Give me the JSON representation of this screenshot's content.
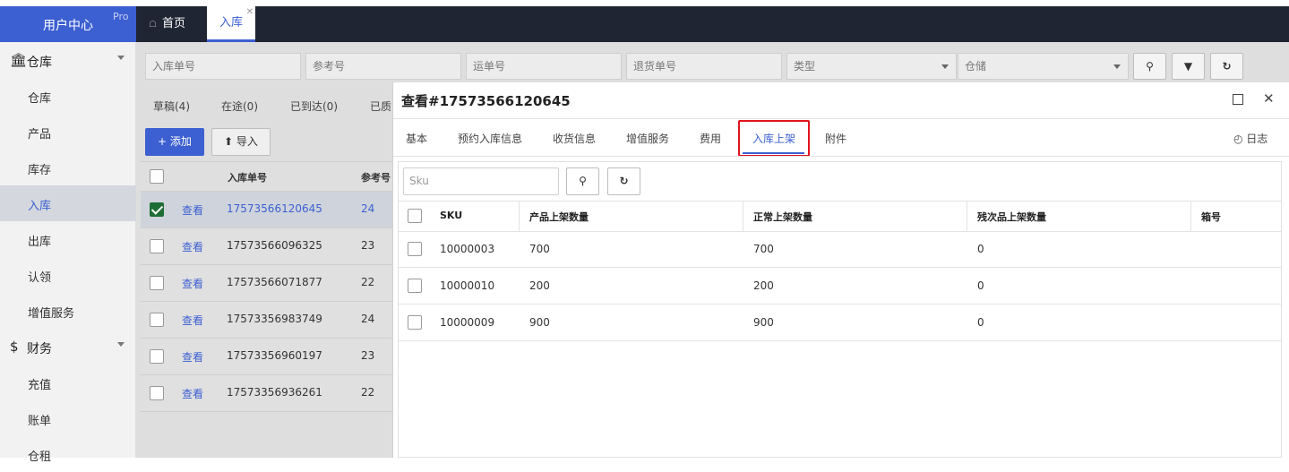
{
  "app": {
    "title": "用户中心",
    "badge": "Pro"
  },
  "top_tabs": [
    {
      "label": "首页"
    },
    {
      "label": "入库"
    }
  ],
  "sidebar": {
    "group_warehouse": "仓库",
    "items_warehouse": [
      "仓库",
      "产品",
      "库存",
      "入库",
      "出库",
      "认领",
      "增值服务"
    ],
    "group_finance": "财务",
    "items_finance": [
      "充值",
      "账单",
      "仓租"
    ]
  },
  "filters": {
    "inbound_no": "入库单号",
    "ref_no": "参考号",
    "tracking_no": "运单号",
    "return_no": "退货单号",
    "type": "类型",
    "warehouse": "仓储"
  },
  "status_tabs": [
    "草稿(4)",
    "在途(0)",
    "已到达(0)",
    "已质"
  ],
  "actions": {
    "add": "添加",
    "import": "导入"
  },
  "list": {
    "headers": {
      "inbound_no": "入库单号",
      "ref": "参考号"
    },
    "view_label": "查看",
    "rows": [
      {
        "no": "17573566120645",
        "ref": "24"
      },
      {
        "no": "17573566096325",
        "ref": "23"
      },
      {
        "no": "17573566071877",
        "ref": "22"
      },
      {
        "no": "17573356983749",
        "ref": "24"
      },
      {
        "no": "17573356960197",
        "ref": "23"
      },
      {
        "no": "17573356936261",
        "ref": "22"
      }
    ]
  },
  "modal": {
    "title": "查看#17573566120645",
    "tabs": [
      "基本",
      "预约入库信息",
      "收货信息",
      "增值服务",
      "费用",
      "入库上架",
      "附件"
    ],
    "log_label": "日志",
    "sku_placeholder": "Sku",
    "table": {
      "headers": [
        "SKU",
        "产品上架数量",
        "正常上架数量",
        "残次品上架数量",
        "箱号"
      ],
      "rows": [
        [
          "10000003",
          "700",
          "700",
          "0",
          ""
        ],
        [
          "10000010",
          "200",
          "200",
          "0",
          ""
        ],
        [
          "10000009",
          "900",
          "900",
          "0",
          ""
        ]
      ]
    }
  },
  "colors": {
    "accent": "#3c5fd1",
    "topbar": "#1f2533",
    "highlight": "#e0141e",
    "check": "#1d6d35"
  }
}
